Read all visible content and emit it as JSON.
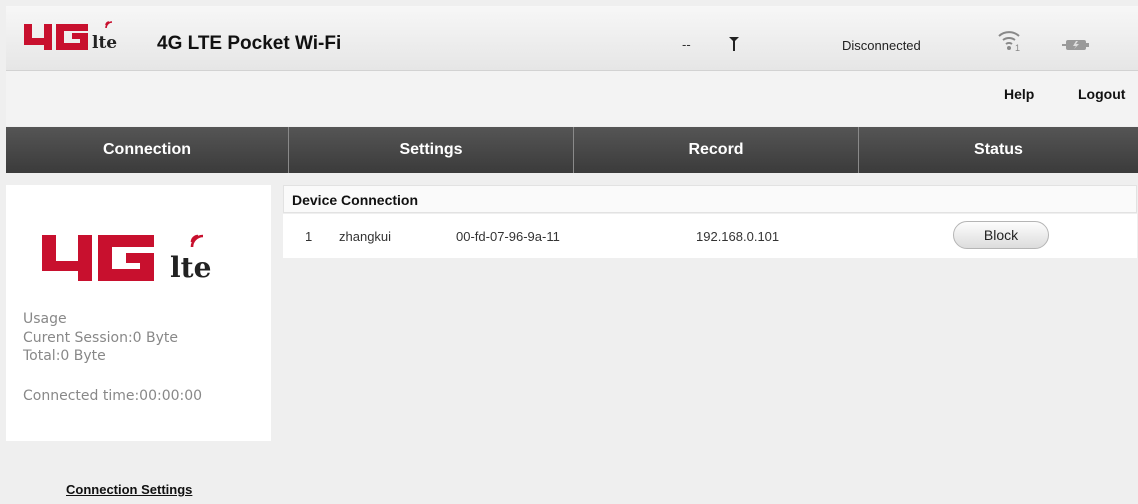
{
  "header": {
    "logo_text": "4G lte",
    "title": "4G LTE Pocket Wi-Fi",
    "signal_text": "--",
    "connection_status": "Disconnected",
    "wifi_clients": "1"
  },
  "top_links": {
    "help": "Help",
    "logout": "Logout"
  },
  "nav": {
    "tabs": [
      {
        "label": "Connection"
      },
      {
        "label": "Settings"
      },
      {
        "label": "Record"
      },
      {
        "label": "Status"
      }
    ]
  },
  "left_panel": {
    "usage_title": "Usage",
    "current_session": "Curent Session:0 Byte",
    "total": "Total:0 Byte",
    "connected_time": "Connected time:00:00:00",
    "connection_settings_link": "Connection Settings"
  },
  "device_connection": {
    "title": "Device Connection",
    "rows": [
      {
        "index": "1",
        "name": "zhangkui",
        "mac": "00-fd-07-96-9a-11",
        "ip": "192.168.0.101",
        "action": "Block"
      }
    ]
  },
  "colors": {
    "brand_red": "#c8102e",
    "nav_bg": "#444444"
  },
  "icons": {
    "antenna": "antenna-icon",
    "wifi": "wifi-icon",
    "battery": "battery-icon"
  }
}
